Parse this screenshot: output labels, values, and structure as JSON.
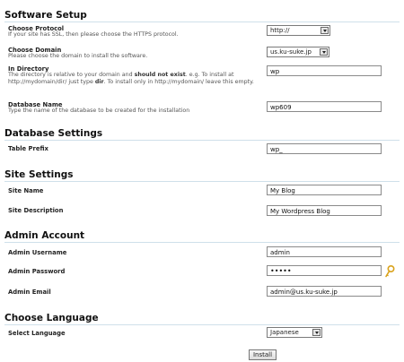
{
  "software_setup": {
    "title": "Software Setup",
    "protocol": {
      "label": "Choose Protocol",
      "description": "If your site has SSL, then please choose the HTTPS protocol.",
      "value": "http://"
    },
    "domain": {
      "label": "Choose Domain",
      "description": "Please choose the domain to install the software.",
      "value": "us.ku-suke.jp"
    },
    "directory": {
      "label": "In Directory",
      "description_prefix": "The directory is relative to your domain and ",
      "description_bold1": "should not exist",
      "description_mid": ". e.g. To install at http://mydomain/dir/ just type ",
      "description_bold2": "dir",
      "description_suffix": ". To install only in http://mydomain/ leave this empty.",
      "value": "wp"
    },
    "database": {
      "label": "Database Name",
      "description": "Type the name of the database to be created for the installation",
      "value": "wp609"
    }
  },
  "database_settings": {
    "title": "Database Settings",
    "table_prefix": {
      "label": "Table Prefix",
      "value": "wp_"
    }
  },
  "site_settings": {
    "title": "Site Settings",
    "site_name": {
      "label": "Site Name",
      "value": "My Blog"
    },
    "site_description": {
      "label": "Site Description",
      "value": "My Wordpress Blog"
    }
  },
  "admin_account": {
    "title": "Admin Account",
    "username": {
      "label": "Admin Username",
      "value": "admin"
    },
    "password": {
      "label": "Admin Password",
      "value": "•••••"
    },
    "email": {
      "label": "Admin Email",
      "value": "admin@us.ku-suke.jp"
    }
  },
  "language": {
    "title": "Choose Language",
    "select": {
      "label": "Select Language",
      "value": "Japanese"
    }
  },
  "install_button": "Install",
  "colors": {
    "section_rule": "#cfe0ea",
    "key_icon": "#d9a21b"
  }
}
